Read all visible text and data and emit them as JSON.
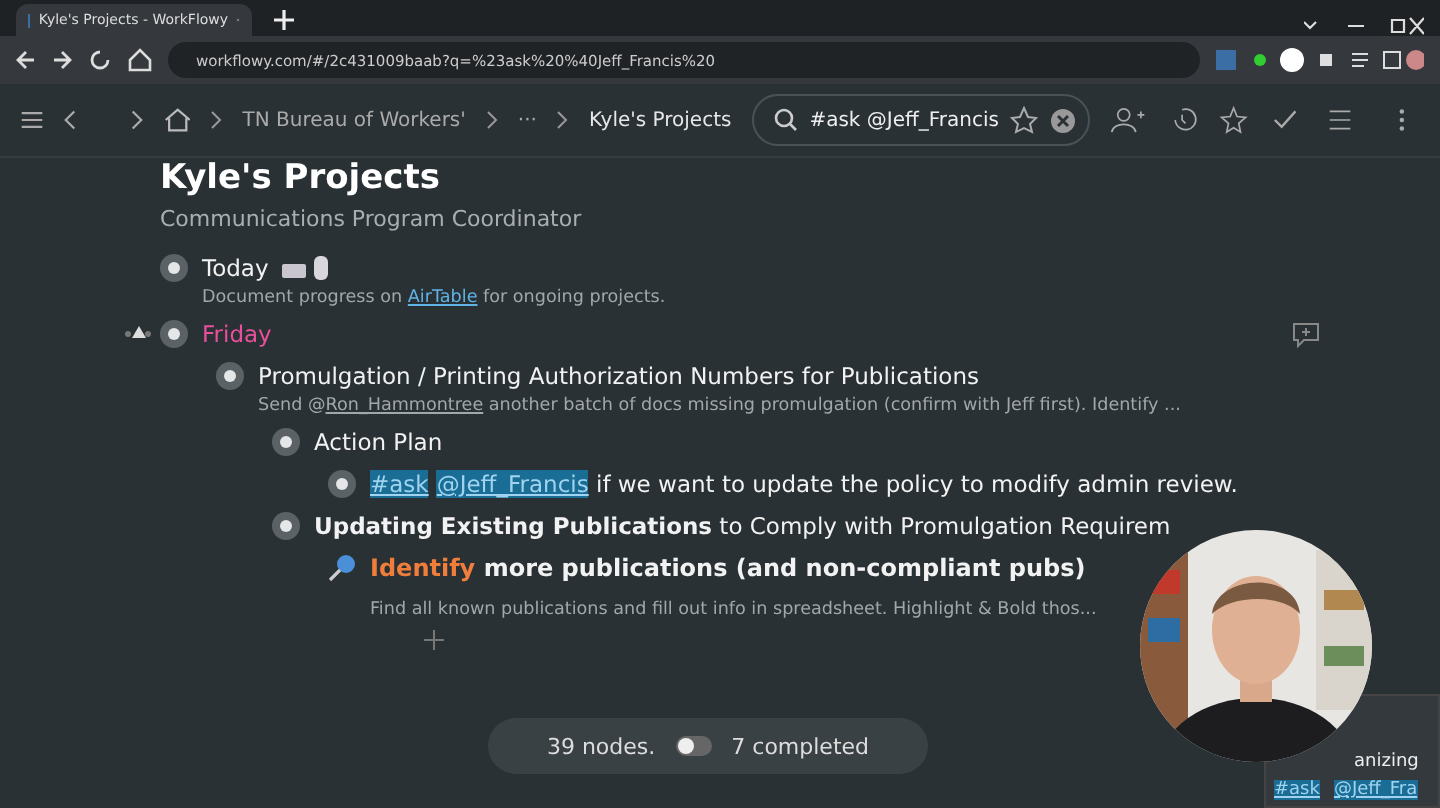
{
  "browser": {
    "tab_title": "Kyle's Projects - WorkFlowy",
    "url": "workflowy.com/#/2c431009baab?q=%23ask%20%40Jeff_Francis%20"
  },
  "toolbar": {
    "breadcrumbs": [
      "TN Bureau of Workers'",
      "···",
      "Kyle's Projects"
    ],
    "search_value": "#ask @Jeff_Francis"
  },
  "page": {
    "title": "Kyle's Projects",
    "subtitle": "Communications Program Coordinator"
  },
  "outline": [
    {
      "kind": "bullet",
      "parts": [
        {
          "kind": "plain",
          "text": "Today"
        }
      ],
      "emoji": true,
      "note": [
        {
          "kind": "plain",
          "text": "Document progress on "
        },
        {
          "kind": "link",
          "text": "AirTable"
        },
        {
          "kind": "plain",
          "text": " for ongoing projects."
        }
      ]
    },
    {
      "kind": "bullet",
      "color": "#e8509c",
      "expanded": true,
      "parts": [
        {
          "kind": "plain",
          "text": "Friday"
        }
      ],
      "children": [
        {
          "kind": "bullet",
          "parts": [
            {
              "kind": "plain",
              "text": "Promulgation / Printing Authorization Numbers for Publications"
            }
          ],
          "note": [
            {
              "kind": "plain",
              "text": "Send @"
            },
            {
              "kind": "mention",
              "text": "Ron_Hammontree"
            },
            {
              "kind": "plain",
              "text": " another batch of docs missing promulgation (confirm with Jeff first).  Identify ..."
            }
          ],
          "children": [
            {
              "kind": "bullet",
              "parts": [
                {
                  "kind": "plain",
                  "text": "Action Plan"
                }
              ],
              "children": [
                {
                  "kind": "bullet",
                  "parts": [
                    {
                      "kind": "tag",
                      "text": "#ask"
                    },
                    {
                      "kind": "tag",
                      "text": "@Jeff_Francis"
                    },
                    {
                      "kind": "plain",
                      "text": " if we want to update the policy to modify admin review."
                    }
                  ]
                }
              ]
            },
            {
              "kind": "bullet",
              "parts": [
                {
                  "kind": "bold",
                  "text": "Updating Existing Publications"
                },
                {
                  "kind": "plain",
                  "text": " to Comply with Promulgation Requirem"
                }
              ],
              "children": [
                {
                  "kind": "pin",
                  "parts": [
                    {
                      "kind": "accent",
                      "text": "Identify"
                    },
                    {
                      "kind": "bold",
                      "text": " more publications (and non-compliant pubs)"
                    }
                  ],
                  "note": [
                    {
                      "kind": "plain",
                      "text": "Find all known publications and fill out info in spreadsheet. Highlight & Bold thos..."
                    }
                  ]
                }
              ]
            }
          ]
        }
      ]
    }
  ],
  "side_card": {
    "text": "anizing",
    "tags": [
      "#ask",
      "@Jeff_Fra"
    ]
  },
  "status": {
    "nodes": "39 nodes.",
    "completed_label": "7 completed",
    "show_completed": false
  }
}
